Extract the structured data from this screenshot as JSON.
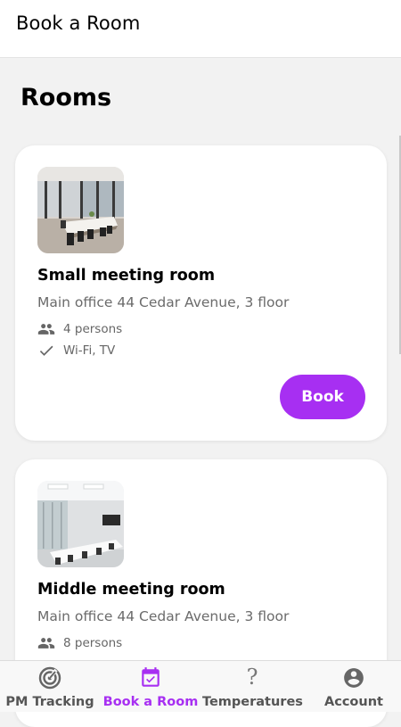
{
  "app_bar": {
    "title": "Book a Room"
  },
  "page": {
    "title": "Rooms"
  },
  "rooms": [
    {
      "name": "Small meeting room",
      "address": "Main office 44 Cedar Avenue, 3 floor",
      "persons": "4 persons",
      "amenities": "Wi-Fi, TV",
      "book_label": "Book"
    },
    {
      "name": "Middle meeting room",
      "address": "Main office 44 Cedar Avenue, 3 floor",
      "persons": "8 persons",
      "amenities": "",
      "book_label": ""
    }
  ],
  "bottom_nav": {
    "items": [
      {
        "label": "PM Tracking",
        "icon": "radar-icon",
        "active": false
      },
      {
        "label": "Book a Room",
        "icon": "calendar-check-icon",
        "active": true
      },
      {
        "label": "Temperatures",
        "icon": "question-mark-icon",
        "active": false
      },
      {
        "label": "Account",
        "icon": "account-circle-icon",
        "active": false
      }
    ]
  },
  "colors": {
    "accent": "#a72ff2",
    "background": "#f2f2f2",
    "card": "#ffffff"
  }
}
